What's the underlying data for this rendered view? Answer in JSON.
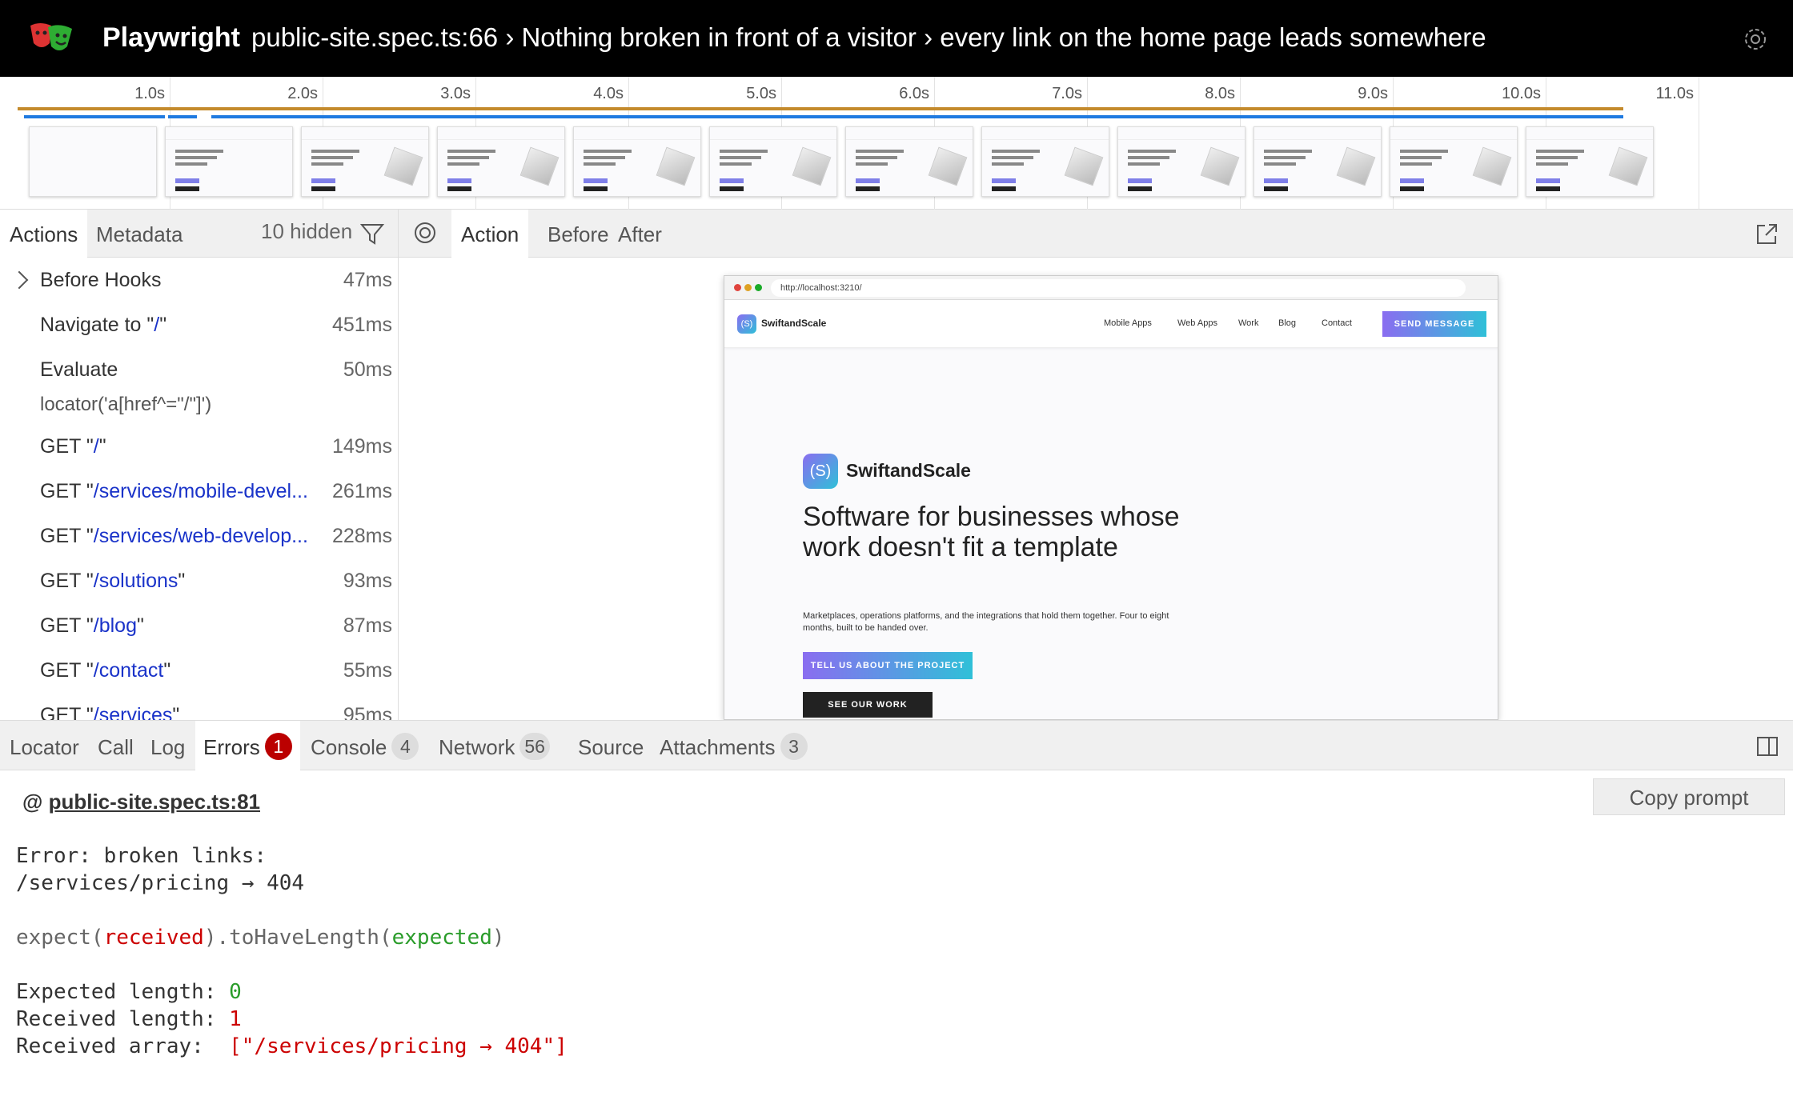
{
  "header": {
    "brand": "Playwright",
    "title": "public-site.spec.ts:66 › Nothing broken in front of a visitor › every link on the home page leads somewhere"
  },
  "timeline": {
    "ticks": [
      "1.0s",
      "2.0s",
      "3.0s",
      "4.0s",
      "5.0s",
      "6.0s",
      "7.0s",
      "8.0s",
      "9.0s",
      "10.0s",
      "11.0s"
    ]
  },
  "left_tabs": {
    "actions": "Actions",
    "metadata": "Metadata",
    "hidden": "10 hidden"
  },
  "actions": [
    {
      "prefix": "Before Hooks",
      "url": "",
      "suffix": "",
      "duration": "47ms"
    },
    {
      "prefix": "Navigate to \"",
      "url": "/",
      "suffix": "\"",
      "duration": "451ms"
    },
    {
      "prefix": "Evaluate",
      "url": "",
      "suffix": "",
      "duration": "50ms",
      "sub": "locator('a[href^=\"/\"]')"
    },
    {
      "prefix": "GET \"",
      "url": "/",
      "suffix": "\"",
      "duration": "149ms"
    },
    {
      "prefix": "GET \"",
      "url": "/services/mobile-devel...",
      "suffix": "",
      "duration": "261ms"
    },
    {
      "prefix": "GET \"",
      "url": "/services/web-develop...",
      "suffix": "",
      "duration": "228ms"
    },
    {
      "prefix": "GET \"",
      "url": "/solutions",
      "suffix": "\"",
      "duration": "93ms"
    },
    {
      "prefix": "GET \"",
      "url": "/blog",
      "suffix": "\"",
      "duration": "87ms"
    },
    {
      "prefix": "GET \"",
      "url": "/contact",
      "suffix": "\"",
      "duration": "55ms"
    },
    {
      "prefix": "GET \"",
      "url": "/services",
      "suffix": "\"",
      "duration": "95ms"
    }
  ],
  "right_tabs": {
    "action": "Action",
    "before": "Before",
    "after": "After"
  },
  "snapshot": {
    "url": "http://localhost:3210/",
    "brand": "SwiftandScale",
    "logo_glyph": "(S)",
    "nav": [
      "Mobile Apps",
      "Web Apps",
      "Work",
      "Blog",
      "Contact"
    ],
    "nav_button": "SEND MESSAGE",
    "hero_title": "Software for businesses whose work doesn't fit a template",
    "hero_sub": "Marketplaces, operations platforms, and the integrations that hold them together. Four to eight months, built to be handed over.",
    "primary_button": "TELL US ABOUT THE PROJECT",
    "secondary_button": "SEE OUR WORK"
  },
  "bottom_tabs": {
    "locator": "Locator",
    "call": "Call",
    "log": "Log",
    "errors": "Errors",
    "errors_count": "1",
    "console": "Console",
    "console_count": "4",
    "network": "Network",
    "network_count": "56",
    "source": "Source",
    "attachments": "Attachments",
    "attachments_count": "3"
  },
  "error": {
    "copy_prompt": "Copy prompt",
    "location_prefix": "@ ",
    "location": "public-site.spec.ts:81",
    "line1": "Error: broken links:",
    "line2": "/services/pricing → 404",
    "expect_prefix": "expect(",
    "expect_received": "received",
    "expect_mid": ").toHaveLength(",
    "expect_expected": "expected",
    "expect_suffix": ")",
    "expected_label": "Expected length: ",
    "expected_value": "0",
    "received_label": "Received length: ",
    "received_value": "1",
    "array_label": "Received array:  ",
    "array_value": "[\"/services/pricing → 404\"]"
  },
  "colors": {
    "header_bg": "#000000",
    "link_blue": "#1a33c9",
    "error_red": "#cc0000",
    "success_green": "#2a9c2a",
    "accent_gradient_start": "#8a6df0",
    "accent_gradient_end": "#2fc0d8",
    "timeline_orange": "#c48a2c",
    "timeline_blue": "#1f7ae0"
  },
  "icons": {
    "logo": "playwright-masks-icon",
    "settings": "gear-icon",
    "filter": "filter-icon",
    "pick_locator": "target-icon",
    "open_external": "popout-icon",
    "toggle_sidebar": "sidebar-toggle-icon",
    "expand": "chevron-right-icon"
  }
}
